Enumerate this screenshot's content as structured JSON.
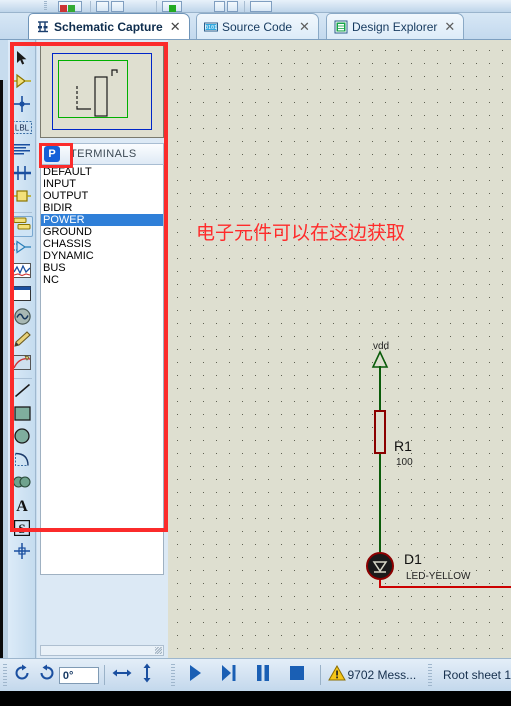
{
  "window": {
    "title": "Schematic Capture"
  },
  "top_toolbar": {
    "icons": [
      "image-button",
      "align-left-icon",
      "align-right-icon",
      "check-icon",
      "text-icon",
      "lamp-icon",
      "graph-icon",
      "box1-icon",
      "box2-icon",
      "edit-icon"
    ]
  },
  "tabs": [
    {
      "label": "Schematic Capture",
      "icon": "schematic-icon",
      "close": "✕",
      "active": true
    },
    {
      "label": "Source Code",
      "icon": "source-code-icon",
      "close": "✕",
      "active": false
    },
    {
      "label": "Design Explorer",
      "icon": "design-explorer-icon",
      "close": "✕",
      "active": false
    }
  ],
  "toolbar": {
    "tools": [
      {
        "name": "selection-mode",
        "icon": "arrow-cursor-icon"
      },
      {
        "name": "component-mode",
        "icon": "component-icon"
      },
      {
        "name": "junction-dot-mode",
        "icon": "junction-dot-icon"
      },
      {
        "name": "wire-label-mode",
        "icon": "label-lbl-icon"
      },
      {
        "name": "text-script-mode",
        "icon": "text-lines-icon"
      },
      {
        "name": "buses-mode",
        "icon": "bus-icon"
      },
      {
        "name": "subcircuit-mode",
        "icon": "subcircuit-icon"
      },
      {
        "name": "device-mode",
        "icon": "device-pick-icon",
        "selected": true
      },
      {
        "name": "terminals-mode",
        "icon": "terminal-icon"
      },
      {
        "name": "graph-mode",
        "icon": "graph-wave-icon"
      },
      {
        "name": "tape-recorder-mode",
        "icon": "window-icon"
      },
      {
        "name": "generator-mode",
        "icon": "generator-icon"
      },
      {
        "name": "voltage-probe-mode",
        "icon": "probe-pen-icon"
      },
      {
        "name": "current-probe-mode",
        "icon": "current-probe-icon"
      },
      {
        "name": "line-mode",
        "icon": "line-icon"
      },
      {
        "name": "box-mode",
        "icon": "rectangle-icon"
      },
      {
        "name": "circle-mode",
        "icon": "circle-icon"
      },
      {
        "name": "arc-mode",
        "icon": "arc-icon"
      },
      {
        "name": "path-mode",
        "icon": "path-icon"
      },
      {
        "name": "text-mode",
        "icon": "text-a-icon"
      },
      {
        "name": "symbol-mode",
        "icon": "symbol-s-icon"
      },
      {
        "name": "marker-mode",
        "icon": "marker-cross-icon"
      }
    ]
  },
  "left_panel": {
    "preview_name": "schematic-preview",
    "picker": {
      "button_label": "P",
      "title": "TERMINALS"
    },
    "terminals": [
      {
        "label": "DEFAULT",
        "selected": false
      },
      {
        "label": "INPUT",
        "selected": false
      },
      {
        "label": "OUTPUT",
        "selected": false
      },
      {
        "label": "BIDIR",
        "selected": false
      },
      {
        "label": "POWER",
        "selected": true
      },
      {
        "label": "GROUND",
        "selected": false
      },
      {
        "label": "CHASSIS",
        "selected": false
      },
      {
        "label": "DYNAMIC",
        "selected": false
      },
      {
        "label": "BUS",
        "selected": false
      },
      {
        "label": "NC",
        "selected": false
      }
    ]
  },
  "canvas": {
    "annotation_text": "电子元件可以在这边获取",
    "annotation_color": "#ff2b2b",
    "power_label": "vdd",
    "components": [
      {
        "ref": "R1",
        "value": "100",
        "type": "resistor"
      },
      {
        "ref": "D1",
        "value": "LED-YELLOW",
        "type": "led"
      }
    ]
  },
  "statusbar": {
    "rotate_cw": "rotate-clockwise-icon",
    "rotate_ccw": "rotate-counterclockwise-icon",
    "rotation_value": "0°",
    "mirror_h": "mirror-horizontal-icon",
    "mirror_v": "mirror-vertical-icon",
    "play": "play-icon",
    "step": "step-icon",
    "pause": "pause-icon",
    "stop": "stop-icon",
    "warning_icon": "warning-icon",
    "messages": "9702 Mess...",
    "sheet": "Root sheet 1"
  }
}
